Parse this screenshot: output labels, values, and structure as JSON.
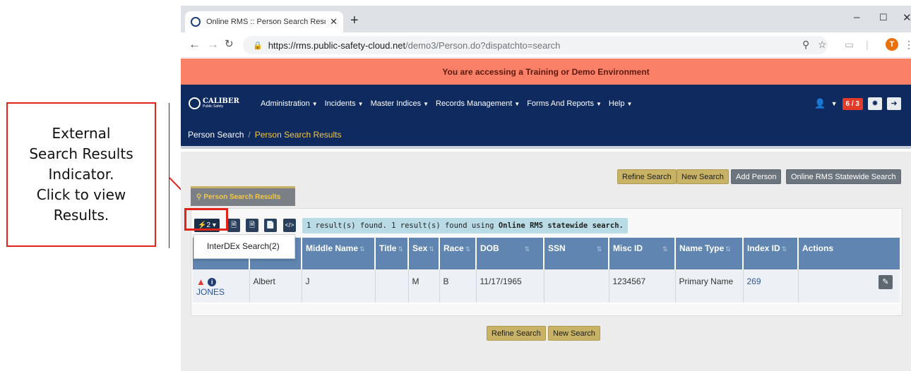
{
  "callout": {
    "text": "External\nSearch Results\nIndicator.\nClick to view\nResults."
  },
  "browser": {
    "tab_title": "Online RMS :: Person Search Resu",
    "tab_close": "✕",
    "new_tab": "+",
    "url_host": "https://rms.public-safety-cloud.net",
    "url_path": "/demo3/Person.do?dispatchto=search",
    "profile_initial": "T"
  },
  "banner": {
    "text": "You are accessing a Training or Demo Environment"
  },
  "brand": {
    "name": "CALIBER",
    "sub": "Public Safety"
  },
  "menu": {
    "items": [
      "Administration",
      "Incidents",
      "Master Indices",
      "Records Management",
      "Forms And Reports",
      "Help"
    ]
  },
  "nav_right": {
    "alert_count": "6 / 3"
  },
  "breadcrumb": {
    "item1": "Person Search",
    "separator": "/",
    "item2": "Person Search Results"
  },
  "actions": {
    "refine_search": "Refine Search",
    "new_search": "New Search",
    "add_person": "Add Person",
    "statewide_search": "Online RMS Statewide Search"
  },
  "results_tab": {
    "label": "Person Search Results"
  },
  "external_indicator": {
    "count": "2"
  },
  "result_message": {
    "prefix": "1 result(s) found. 1 result(s) found using ",
    "bold": "Online RMS statewide search."
  },
  "table": {
    "headers": [
      "",
      "",
      "Middle Name",
      "Title",
      "Sex",
      "Race",
      "DOB",
      "SSN",
      "Misc ID",
      "Name Type",
      "Index ID",
      "Actions"
    ],
    "row": {
      "last_name": "JONES",
      "first_name": "Albert",
      "middle_name": "J",
      "title": "",
      "sex": "M",
      "race": "B",
      "dob": "11/17/1965",
      "ssn": "",
      "misc_id": "1234567",
      "name_type": "Primary Name",
      "index_id": "269"
    }
  },
  "dropdown": {
    "item": "InterDEx Search(2)"
  },
  "bottom_actions": {
    "refine_search": "Refine Search",
    "new_search": "New Search"
  },
  "colors": {
    "banner": "#fb8068",
    "navbar": "#0f2a5f",
    "gold": "#c8b266",
    "highlight": "#e2231a"
  }
}
